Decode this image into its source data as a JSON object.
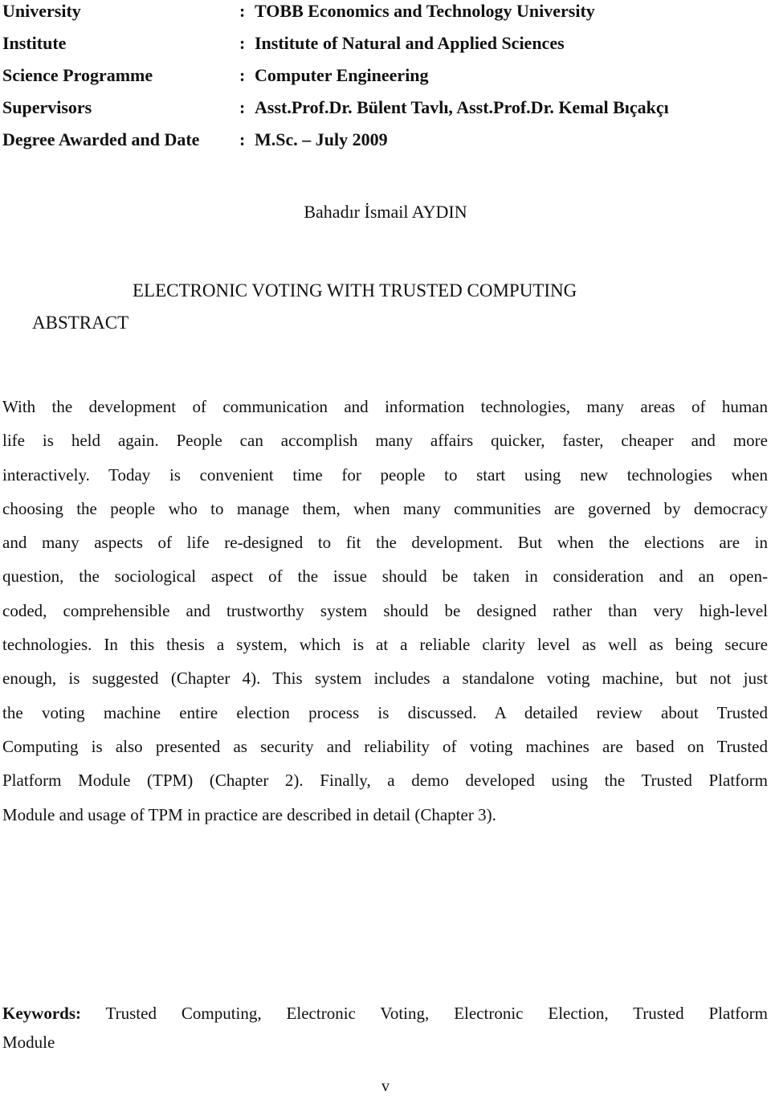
{
  "metadata": [
    {
      "label": "University",
      "colon": ":",
      "value": "TOBB Economics and Technology University"
    },
    {
      "label": "Institute",
      "colon": ":",
      "value": "Institute of Natural and Applied Sciences"
    },
    {
      "label": "Science Programme",
      "colon": ":",
      "value": "Computer Engineering"
    },
    {
      "label": "Supervisors",
      "colon": ":",
      "value": "Asst.Prof.Dr. Bülent Tavlı, Asst.Prof.Dr. Kemal Bıçakçı"
    },
    {
      "label": "Degree Awarded and Date",
      "colon": ":",
      "value": "M.Sc. – July 2009"
    }
  ],
  "author": "Bahadır İsmail AYDIN",
  "title": "ELECTRONIC VOTING WITH TRUSTED COMPUTING",
  "abstract_heading": "ABSTRACT",
  "abstract_lines": [
    "With the development of communication and information technologies, many areas of human",
    "life is held again. People can accomplish many affairs quicker, faster, cheaper and more",
    "interactively. Today is convenient time for people to start using new technologies  when",
    "choosing the people who to manage them, when many communities are governed by democracy",
    "and many aspects of life re-designed to fit the development. But when the elections are in",
    "question, the sociological aspect of the issue should be taken  in consideration and an open-",
    "coded, comprehensible and trustworthy system should be designed rather than very high-level",
    "technologies. In this thesis a system, which is at a reliable clarity level as well as being secure",
    "enough, is suggested (Chapter 4). This system includes a standalone voting machine, but not just",
    "the voting machine entire election process is discussed. A detailed review about Trusted",
    "Computing is also presented as security and reliability of voting machines are based on Trusted",
    "Platform Module (TPM) (Chapter 2). Finally, a demo developed using the Trusted Platform",
    "Module and usage of TPM in practice  are described in detail (Chapter 3)."
  ],
  "keywords": {
    "label": "Keywords:",
    "line1": "Trusted Computing, Electronic Voting, Electronic Election, Trusted Platform",
    "line2": "Module"
  },
  "page_number": "v"
}
